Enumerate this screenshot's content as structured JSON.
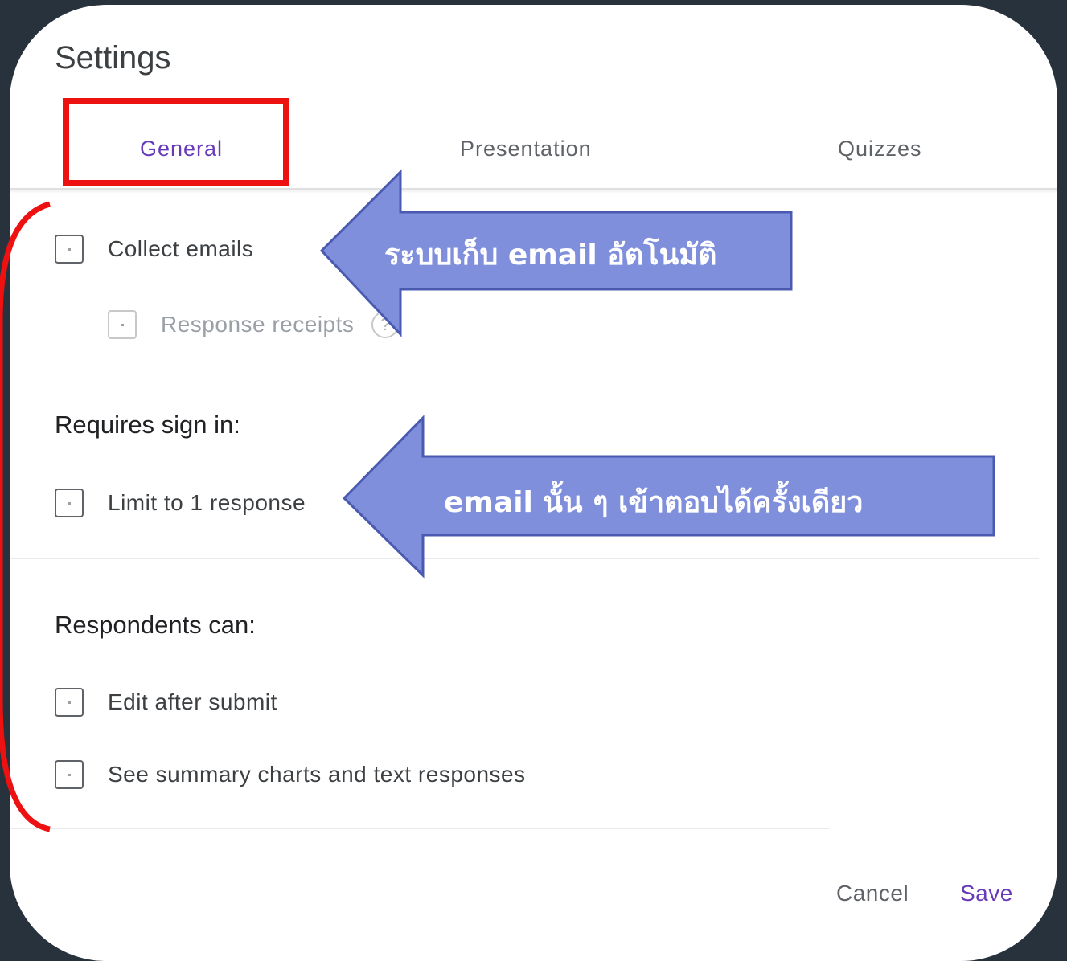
{
  "dialog": {
    "title": "Settings",
    "tabs": [
      {
        "label": "General",
        "active": true
      },
      {
        "label": "Presentation",
        "active": false
      },
      {
        "label": "Quizzes",
        "active": false
      }
    ],
    "options": {
      "collect_emails": "Collect emails",
      "response_receipts": "Response receipts",
      "requires_sign_in": "Requires sign in:",
      "limit_response": "Limit to 1 response",
      "respondents_can": "Respondents can:",
      "edit_after_submit": "Edit after submit",
      "see_summary": "See summary charts and text responses"
    },
    "footer": {
      "cancel": "Cancel",
      "save": "Save"
    }
  },
  "annotations": {
    "arrow1_text": "ระบบเก็บ email อัตโนมัติ",
    "arrow2_text": "email นั้น ๆ เข้าตอบได้ครั้งเดียว",
    "arrow_fill": "#7f8fdc",
    "arrow_stroke": "#4a5ab0",
    "highlight_color": "#ee1111"
  },
  "help_icon_glyph": "?"
}
